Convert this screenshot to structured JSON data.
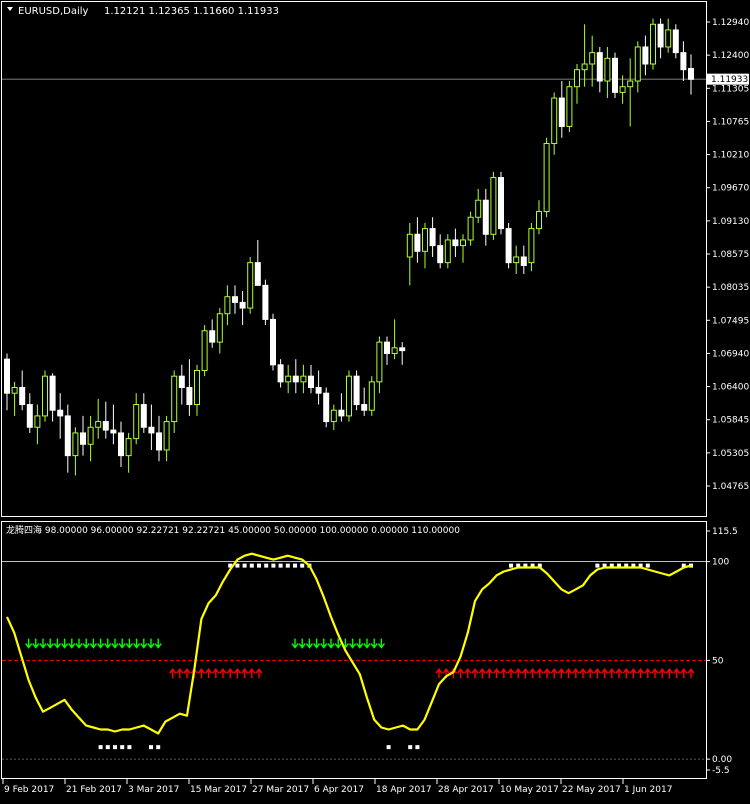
{
  "header": {
    "symbol_tf": "EURUSD,Daily",
    "ohlc": "1.12121 1.12365 1.11660 1.11933"
  },
  "price_axis": {
    "ticks": [
      "1.12940",
      "1.12400",
      "1.11305",
      "1.10765",
      "1.10210",
      "1.09670",
      "1.09130",
      "1.08575",
      "1.08035",
      "1.07495",
      "1.06940",
      "1.06400",
      "1.05845",
      "1.05305",
      "1.04765"
    ],
    "current": "1.11933"
  },
  "indicator": {
    "title": "龙腾四海 98.00000 96.00000 92.22721 92.22721 45.00000 50.00000 100.00000 0.00000 110.00000",
    "axis_ticks": [
      "115.5",
      "100",
      "50",
      "0.00",
      "-5.5"
    ]
  },
  "dates": [
    "9 Feb 2017",
    "21 Feb 2017",
    "3 Mar 2017",
    "15 Mar 2017",
    "27 Mar 2017",
    "6 Apr 2017",
    "18 Apr 2017",
    "28 Apr 2017",
    "10 May 2017",
    "22 May 2017",
    "1 Jun 2017"
  ],
  "colors": {
    "bg": "#000000",
    "bull": "#ADFF2F",
    "bear": "#FFFFFF",
    "line": "#FFFF00",
    "buy_arrow": "#00FF00",
    "sell_arrow": "#FF0000",
    "level": "#FF0000"
  },
  "chart_data": {
    "type": "candlestick",
    "symbol": "EURUSD",
    "timeframe": "Daily",
    "ylim": [
      1.04765,
      1.1294
    ],
    "last_price": 1.11933,
    "candles": [
      [
        1.07,
        1.071,
        1.061,
        1.064
      ],
      [
        1.064,
        1.066,
        1.06,
        1.065
      ],
      [
        1.065,
        1.068,
        1.061,
        1.062
      ],
      [
        1.062,
        1.064,
        1.057,
        1.058
      ],
      [
        1.058,
        1.062,
        1.055,
        1.06
      ],
      [
        1.06,
        1.068,
        1.059,
        1.067
      ],
      [
        1.067,
        1.0675,
        1.059,
        1.061
      ],
      [
        1.061,
        1.064,
        1.056,
        1.06
      ],
      [
        1.06,
        1.062,
        1.05,
        1.053
      ],
      [
        1.053,
        1.058,
        1.0495,
        1.057
      ],
      [
        1.057,
        1.06,
        1.053,
        1.055
      ],
      [
        1.055,
        1.06,
        1.052,
        1.058
      ],
      [
        1.058,
        1.063,
        1.056,
        1.059
      ],
      [
        1.059,
        1.0625,
        1.056,
        1.0575
      ],
      [
        1.0575,
        1.062,
        1.055,
        1.057
      ],
      [
        1.057,
        1.059,
        1.051,
        1.053
      ],
      [
        1.053,
        1.057,
        1.05,
        1.056
      ],
      [
        1.056,
        1.064,
        1.055,
        1.062
      ],
      [
        1.062,
        1.064,
        1.057,
        1.058
      ],
      [
        1.058,
        1.062,
        1.054,
        1.057
      ],
      [
        1.057,
        1.06,
        1.052,
        1.054
      ],
      [
        1.054,
        1.06,
        1.052,
        1.059
      ],
      [
        1.059,
        1.068,
        1.057,
        1.067
      ],
      [
        1.067,
        1.069,
        1.062,
        1.065
      ],
      [
        1.065,
        1.07,
        1.06,
        1.062
      ],
      [
        1.062,
        1.069,
        1.06,
        1.068
      ],
      [
        1.068,
        1.076,
        1.067,
        1.075
      ],
      [
        1.075,
        1.077,
        1.072,
        1.073
      ],
      [
        1.073,
        1.079,
        1.071,
        1.078
      ],
      [
        1.078,
        1.083,
        1.076,
        1.081
      ],
      [
        1.081,
        1.083,
        1.078,
        1.08
      ],
      [
        1.08,
        1.082,
        1.076,
        1.079
      ],
      [
        1.079,
        1.088,
        1.078,
        1.087
      ],
      [
        1.087,
        1.091,
        1.084,
        1.083
      ],
      [
        1.083,
        1.084,
        1.076,
        1.077
      ],
      [
        1.077,
        1.078,
        1.068,
        1.069
      ],
      [
        1.069,
        1.07,
        1.065,
        1.066
      ],
      [
        1.066,
        1.069,
        1.064,
        1.067
      ],
      [
        1.067,
        1.07,
        1.064,
        1.066
      ],
      [
        1.066,
        1.069,
        1.064,
        1.067
      ],
      [
        1.067,
        1.069,
        1.064,
        1.065
      ],
      [
        1.065,
        1.068,
        1.062,
        1.064
      ],
      [
        1.064,
        1.065,
        1.058,
        1.059
      ],
      [
        1.059,
        1.062,
        1.0575,
        1.061
      ],
      [
        1.061,
        1.064,
        1.059,
        1.06
      ],
      [
        1.06,
        1.068,
        1.059,
        1.067
      ],
      [
        1.067,
        1.068,
        1.061,
        1.062
      ],
      [
        1.062,
        1.065,
        1.06,
        1.061
      ],
      [
        1.061,
        1.067,
        1.06,
        1.066
      ],
      [
        1.066,
        1.074,
        1.064,
        1.073
      ],
      [
        1.073,
        1.074,
        1.069,
        1.071
      ],
      [
        1.071,
        1.077,
        1.07,
        1.072
      ],
      [
        1.072,
        1.073,
        1.069,
        1.0715
      ],
      [
        1.088,
        1.094,
        1.083,
        1.092
      ],
      [
        1.092,
        1.095,
        1.087,
        1.089
      ],
      [
        1.089,
        1.094,
        1.086,
        1.093
      ],
      [
        1.093,
        1.095,
        1.088,
        1.09
      ],
      [
        1.09,
        1.092,
        1.086,
        1.087
      ],
      [
        1.087,
        1.092,
        1.086,
        1.091
      ],
      [
        1.091,
        1.093,
        1.088,
        1.09
      ],
      [
        1.09,
        1.092,
        1.087,
        1.091
      ],
      [
        1.091,
        1.096,
        1.09,
        1.095
      ],
      [
        1.095,
        1.1,
        1.094,
        1.098
      ],
      [
        1.098,
        1.1,
        1.09,
        1.092
      ],
      [
        1.092,
        1.103,
        1.091,
        1.102
      ],
      [
        1.102,
        1.103,
        1.092,
        1.093
      ],
      [
        1.093,
        1.094,
        1.086,
        1.087
      ],
      [
        1.087,
        1.09,
        1.085,
        1.088
      ],
      [
        1.088,
        1.09,
        1.085,
        1.0865
      ],
      [
        1.087,
        1.094,
        1.0855,
        1.093
      ],
      [
        1.093,
        1.098,
        1.092,
        1.096
      ],
      [
        1.096,
        1.109,
        1.095,
        1.108
      ],
      [
        1.108,
        1.117,
        1.106,
        1.116
      ],
      [
        1.116,
        1.119,
        1.109,
        1.111
      ],
      [
        1.111,
        1.119,
        1.11,
        1.118
      ],
      [
        1.118,
        1.122,
        1.115,
        1.121
      ],
      [
        1.121,
        1.129,
        1.118,
        1.122
      ],
      [
        1.122,
        1.127,
        1.118,
        1.124
      ],
      [
        1.124,
        1.125,
        1.117,
        1.119
      ],
      [
        1.119,
        1.125,
        1.116,
        1.123
      ],
      [
        1.123,
        1.124,
        1.116,
        1.117
      ],
      [
        1.117,
        1.12,
        1.115,
        1.118
      ],
      [
        1.118,
        1.123,
        1.111,
        1.119
      ],
      [
        1.119,
        1.126,
        1.117,
        1.125
      ],
      [
        1.125,
        1.127,
        1.12,
        1.122
      ],
      [
        1.122,
        1.13,
        1.121,
        1.129
      ],
      [
        1.129,
        1.13,
        1.123,
        1.125
      ],
      [
        1.125,
        1.13,
        1.124,
        1.128
      ],
      [
        1.128,
        1.129,
        1.123,
        1.124
      ],
      [
        1.124,
        1.126,
        1.119,
        1.121
      ],
      [
        1.1212,
        1.1237,
        1.1166,
        1.1193
      ]
    ],
    "indicator": {
      "name": "龙腾四海",
      "levels": [
        0,
        50,
        100
      ],
      "ylim": [
        -5.5,
        115.5
      ],
      "line": [
        72,
        64,
        52,
        40,
        31,
        24,
        26,
        28,
        30,
        25,
        21,
        17,
        16,
        15,
        15,
        14,
        15,
        15,
        16,
        17,
        15,
        13,
        19,
        21,
        23,
        22,
        45,
        71,
        79,
        83,
        90,
        96,
        101,
        103,
        104,
        103,
        102,
        101,
        102,
        103,
        102,
        101,
        98,
        91,
        82,
        72,
        63,
        55,
        49,
        43,
        31,
        20,
        16,
        15,
        16,
        17,
        15,
        15,
        20,
        29,
        38,
        42,
        44,
        52,
        64,
        80,
        86,
        89,
        93,
        95,
        96,
        97,
        97,
        97,
        97,
        94,
        90,
        86,
        84,
        86,
        88,
        93,
        96,
        97,
        97,
        97,
        97,
        97,
        97,
        96,
        95,
        94,
        93,
        95,
        97,
        98
      ]
    }
  }
}
